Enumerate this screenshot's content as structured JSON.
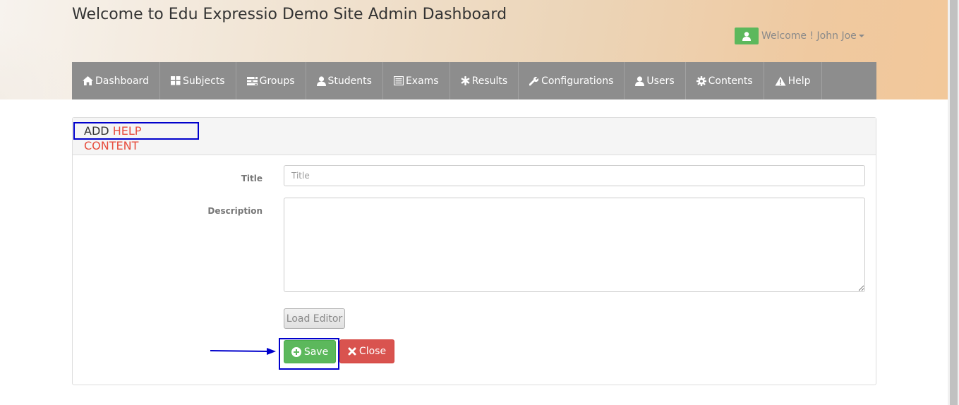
{
  "header": {
    "site_title": "Welcome to Edu Expressio Demo Site Admin Dashboard",
    "user_greeting": "Welcome ! John Joe"
  },
  "nav": {
    "items": [
      {
        "label": "Dashboard",
        "icon": "home-icon"
      },
      {
        "label": "Subjects",
        "icon": "th-large-icon"
      },
      {
        "label": "Groups",
        "icon": "tasks-icon"
      },
      {
        "label": "Students",
        "icon": "user-icon"
      },
      {
        "label": "Exams",
        "icon": "list-alt-icon"
      },
      {
        "label": "Results",
        "icon": "asterisk-icon"
      },
      {
        "label": "Configurations",
        "icon": "wrench-icon"
      },
      {
        "label": "Users",
        "icon": "user-icon"
      },
      {
        "label": "Contents",
        "icon": "cog-icon"
      },
      {
        "label": "Help",
        "icon": "warning-icon"
      }
    ]
  },
  "panel": {
    "heading_prefix": "ADD",
    "heading_accent": "HELP CONTENT"
  },
  "form": {
    "title_label": "Title",
    "title_placeholder": "Title",
    "title_value": "",
    "description_label": "Description",
    "description_value": "",
    "load_editor_label": "Load Editor",
    "save_label": "Save",
    "close_label": "Close"
  },
  "colors": {
    "nav_bg": "#8d8d8d",
    "accent": "#e74c3c",
    "save": "#5cb85c",
    "close": "#d9534f",
    "annotation": "#0000cc"
  }
}
